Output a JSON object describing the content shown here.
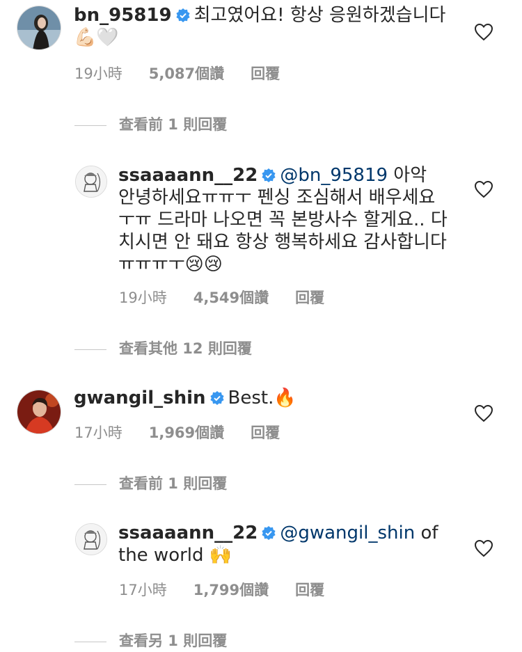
{
  "comments": [
    {
      "username": "bn_95819",
      "text": "최고였어요! 항상 응원하겠습니다",
      "emoji": "💪🏻🤍",
      "time": "19小時",
      "likes": "5,087個讚",
      "reply": "回覆",
      "view_replies": "查看前 1 則回覆"
    },
    {
      "username": "ssaaaann__22",
      "mention": "@bn_95819",
      "text": " 아악 안녕하세요ㅠㅠㅜ 펜싱 조심해서 배우세요ㅜㅠ 드라마 나오면 꼭 본방사수 할게요.. 다치시면 안 돼요 항상 행복하세요 감사합니다ㅠㅠㅠㅜ😢😢",
      "time": "19小時",
      "likes": "4,549個讚",
      "reply": "回覆",
      "view_replies": "查看其他 12 則回覆"
    },
    {
      "username": "gwangil_shin",
      "text": "Best.🔥",
      "time": "17小時",
      "likes": "1,969個讚",
      "reply": "回覆",
      "view_replies": "查看前 1 則回覆"
    },
    {
      "username": "ssaaaann__22",
      "mention": "@gwangil_shin",
      "text": " of the world 🙌",
      "time": "17小時",
      "likes": "1,799個讚",
      "reply": "回覆",
      "view_replies": "查看另 1 則回覆"
    }
  ],
  "colors": {
    "verified": "#3897f0",
    "mention": "#00376b",
    "meta": "#8e8e8e"
  }
}
